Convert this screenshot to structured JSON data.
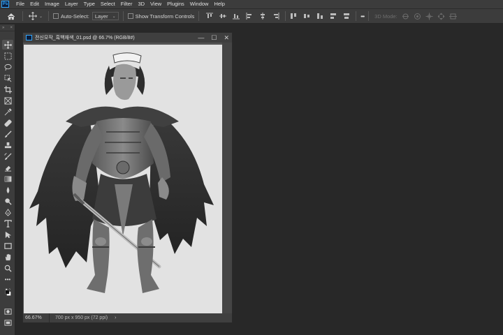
{
  "app": {
    "logo_text": "Ps"
  },
  "menu": [
    "File",
    "Edit",
    "Image",
    "Layer",
    "Type",
    "Select",
    "Filter",
    "3D",
    "View",
    "Plugins",
    "Window",
    "Help"
  ],
  "options_bar": {
    "auto_select_label": "Auto-Select:",
    "auto_select_value": "Layer",
    "show_transform_label": "Show Transform Controls",
    "mode_3d_label": "3D Mode:",
    "more_label": "•••"
  },
  "toolbar": {
    "collapse_label": "»",
    "close_label": "×",
    "more_label": "•••"
  },
  "document": {
    "title": "전신모작_흑백재색_01.psd @ 66.7% (RGB/8#)",
    "zoom": "66.67%",
    "info": "700 px x 950 px (72 ppi)",
    "status_arrow": "›",
    "minimize": "—",
    "maximize": "☐",
    "close": "✕"
  },
  "colors": {
    "menubar_bg": "#3c3c3c",
    "workspace_bg": "#282828",
    "accent": "#31a8ff",
    "canvas_bg": "#e2e2e2"
  }
}
